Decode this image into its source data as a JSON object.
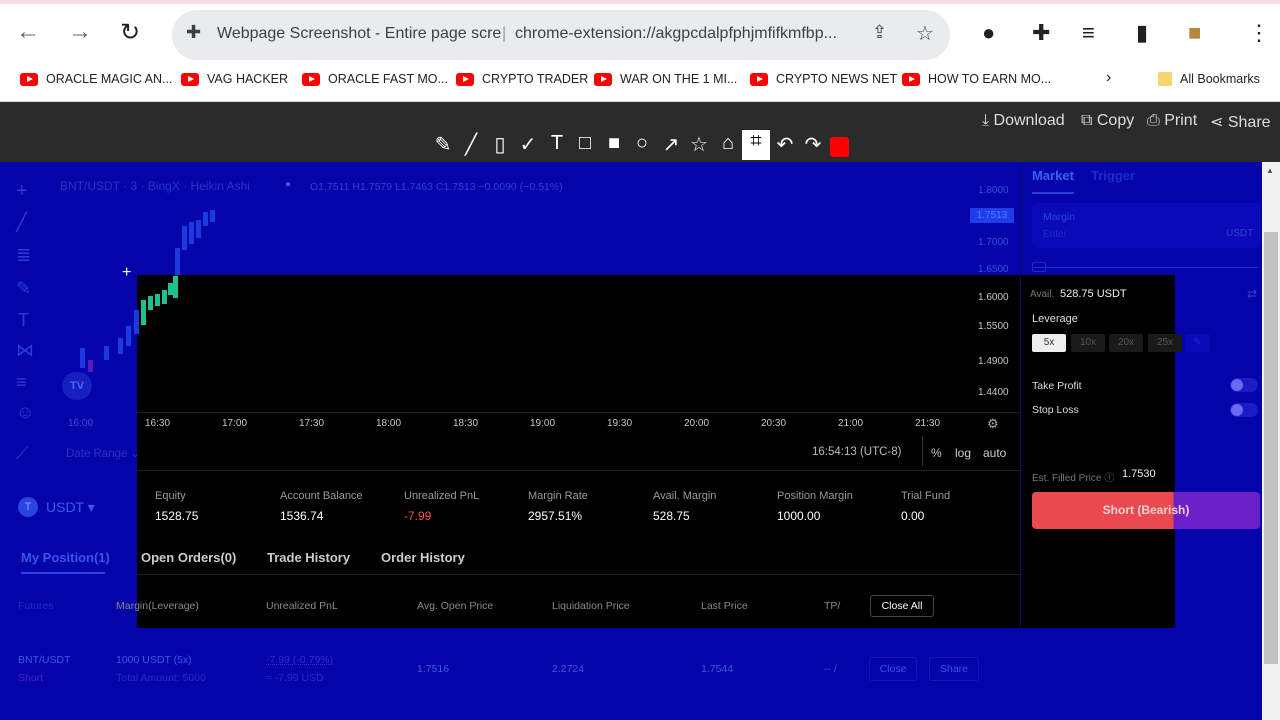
{
  "browser": {
    "tab_title": "Webpage Screenshot - Entire page scre",
    "url": "chrome-extension://akgpcdalpfphjmfifkmfbp...",
    "bookmarks": [
      "ORACLE MAGIC AN...",
      "VAG HACKER",
      "ORACLE FAST MO...",
      "CRYPTO TRADER",
      "WAR ON THE 1 MI...",
      "CRYPTO NEWS NET",
      "HOW TO EARN MO..."
    ],
    "all_bookmarks": "All Bookmarks"
  },
  "toolbar": {
    "download": "Download",
    "copy": "Copy",
    "print": "Print",
    "share": "Share",
    "color": "#ff0000"
  },
  "chart": {
    "symbol": "BNT/USDT · 3 · BingX · Heikin Ashi",
    "ohlc": "O1.7511 H1.7579 L1.7463 C1.7513 −0.0090 (−0.51%)",
    "price_badge": "1.7513",
    "price_ticks_outside": [
      "1.8000",
      "1.7000",
      "1.6500"
    ],
    "price_ticks_inside": [
      "1.6000",
      "1.5500",
      "1.4900",
      "1.4400"
    ],
    "time_outside": "16:00",
    "time_ticks": [
      "16:30",
      "17:00",
      "17:30",
      "18:00",
      "18:30",
      "19:00",
      "19:30",
      "20:00",
      "20:30",
      "21:00",
      "21:30"
    ],
    "date_range": "Date Range",
    "clock": "16:54:13 (UTC-8)",
    "pct": "%",
    "log": "log",
    "auto": "auto"
  },
  "account": {
    "currency": "USDT",
    "stats": [
      {
        "label": "Equity",
        "value": "1528.75"
      },
      {
        "label": "Account Balance",
        "value": "1536.74"
      },
      {
        "label": "Unrealized PnL",
        "value": "-7.99"
      },
      {
        "label": "Margin Rate",
        "value": "2957.51%"
      },
      {
        "label": "Avail. Margin",
        "value": "528.75"
      },
      {
        "label": "Position Margin",
        "value": "1000.00"
      },
      {
        "label": "Trial Fund",
        "value": "0.00"
      }
    ],
    "tabs": [
      "My Position(1)",
      "Open Orders(0)",
      "Trade History",
      "Order History"
    ]
  },
  "positions": {
    "headers": [
      "Futures",
      "Margin(Leverage)",
      "Unrealized PnL",
      "Avg. Open Price",
      "Liquidation Price",
      "Last Price",
      "TP/"
    ],
    "close_all": "Close All",
    "row": {
      "pair": "BNT/USDT",
      "side": "Short",
      "margin": "1000 USDT (5x)",
      "total": "Total Amount: 5000",
      "pnl": "-7.99 (-0.79%)",
      "pnl_usd": "≈ -7.99 USD",
      "avg_open": "1.7516",
      "liq": "2.2724",
      "last": "1.7544",
      "tpsl": "-- /",
      "close": "Close",
      "share": "Share"
    }
  },
  "order": {
    "tabs": [
      "Market",
      "Trigger"
    ],
    "margin_label": "Margin",
    "margin_placeholder": "Enter",
    "margin_unit": "USDT",
    "avail_label": "Avail.",
    "avail_value": "528.75 USDT",
    "leverage_label": "Leverage",
    "leverage_options": [
      "5x",
      "10x",
      "20x",
      "25x"
    ],
    "leverage_selected": "5x",
    "take_profit": "Take Profit",
    "stop_loss": "Stop Loss",
    "est_label": "Est. Filled Price ⓘ",
    "est_value": "1.7530",
    "short_button": "Short (Bearish)"
  }
}
